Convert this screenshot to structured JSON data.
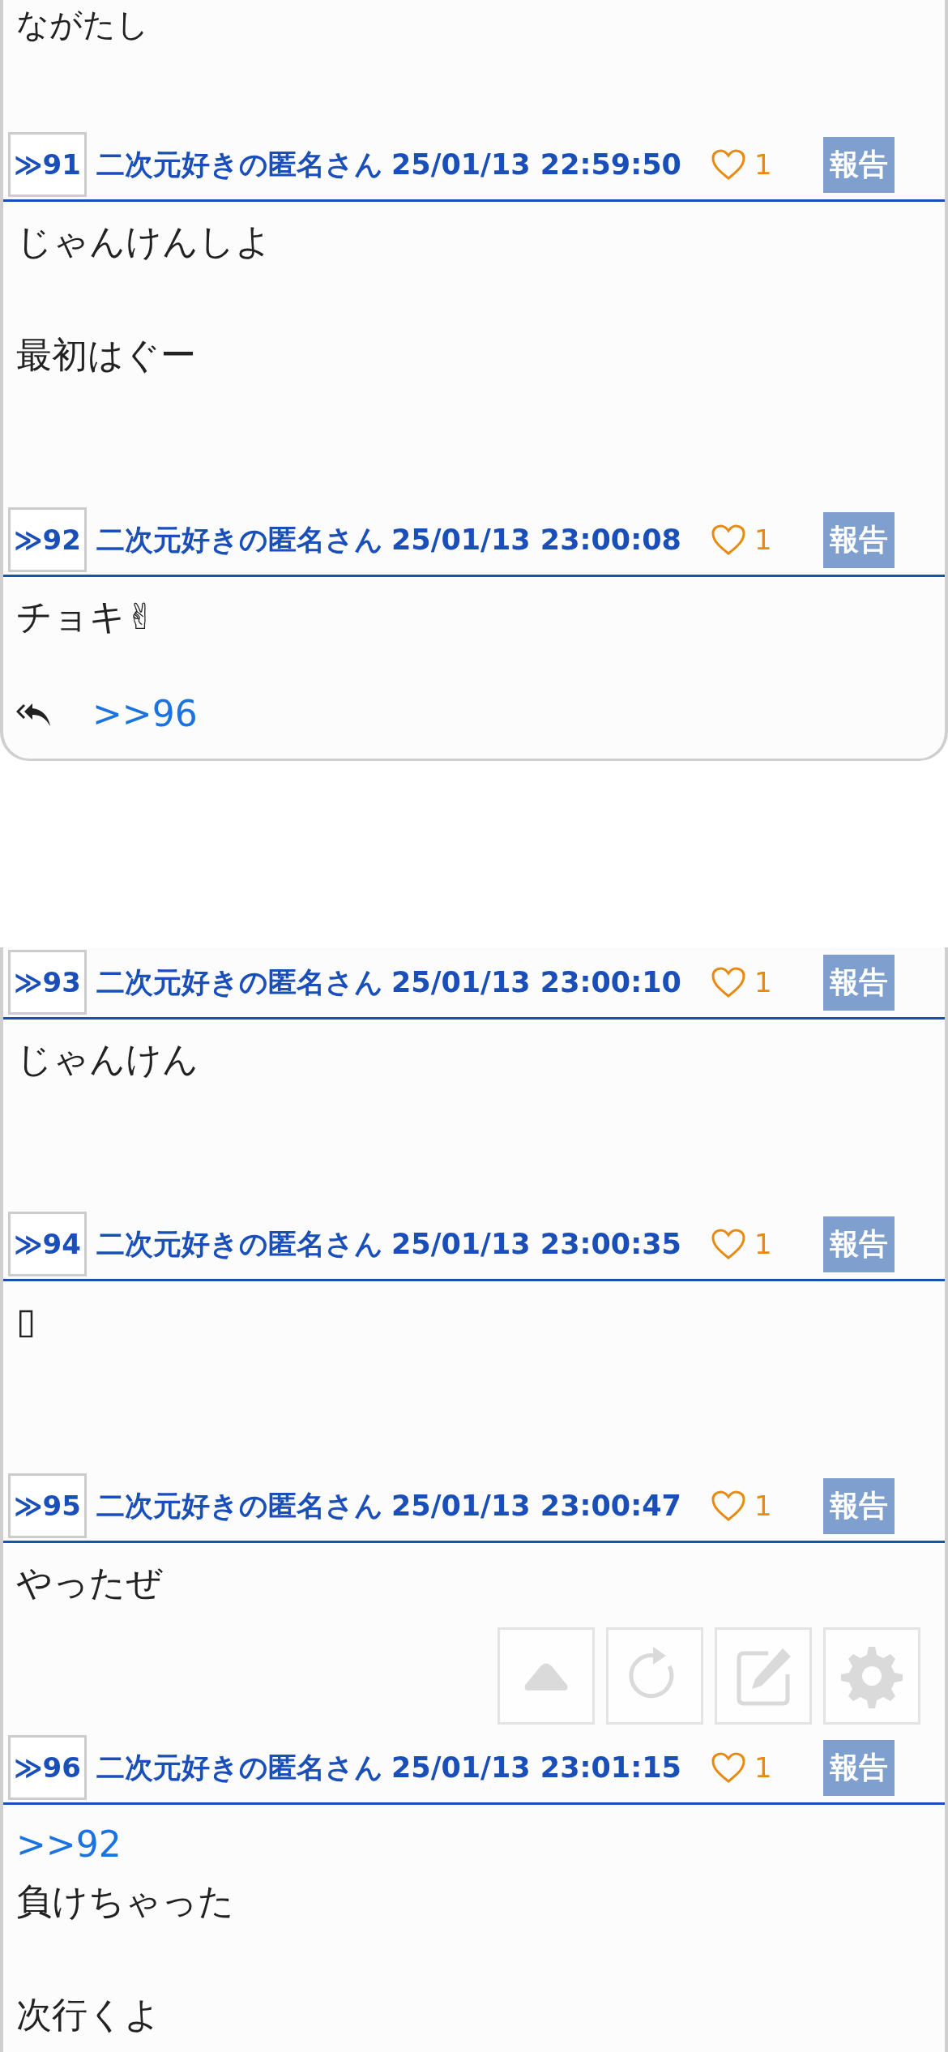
{
  "top_text": "ながたし",
  "sections": [
    {
      "posts": [
        {
          "number": "≫91",
          "author": "二次元好きの匿名さん",
          "date": "25/01/13 22:59:50",
          "likes": "1",
          "report": "報告",
          "body": [
            {
              "text": "じゃんけんしよ"
            },
            {
              "text": "最初はぐー"
            }
          ]
        },
        {
          "number": "≫92",
          "author": "二次元好きの匿名さん",
          "date": "25/01/13 23:00:08",
          "likes": "1",
          "report": "報告",
          "body": [
            {
              "text": "チョキ✌"
            }
          ],
          "replies": [
            ">>96"
          ]
        }
      ]
    },
    {
      "posts": [
        {
          "number": "≫93",
          "author": "二次元好きの匿名さん",
          "date": "25/01/13 23:00:10",
          "likes": "1",
          "report": "報告",
          "body": [
            {
              "text": "じゃんけん"
            }
          ]
        },
        {
          "number": "≫94",
          "author": "二次元好きの匿名さん",
          "date": "25/01/13 23:00:35",
          "likes": "1",
          "report": "報告",
          "body": [
            {
              "text": "▯"
            }
          ]
        },
        {
          "number": "≫95",
          "author": "二次元好きの匿名さん",
          "date": "25/01/13 23:00:47",
          "likes": "1",
          "report": "報告",
          "body": [
            {
              "text": "やったぜ"
            }
          ]
        },
        {
          "number": "≫96",
          "author": "二次元好きの匿名さん",
          "date": "25/01/13 23:01:15",
          "likes": "1",
          "report": "報告",
          "quote": ">>92",
          "body": [
            {
              "text": "負けちゃった"
            },
            {
              "text": "次行くよ"
            }
          ]
        }
      ]
    }
  ]
}
